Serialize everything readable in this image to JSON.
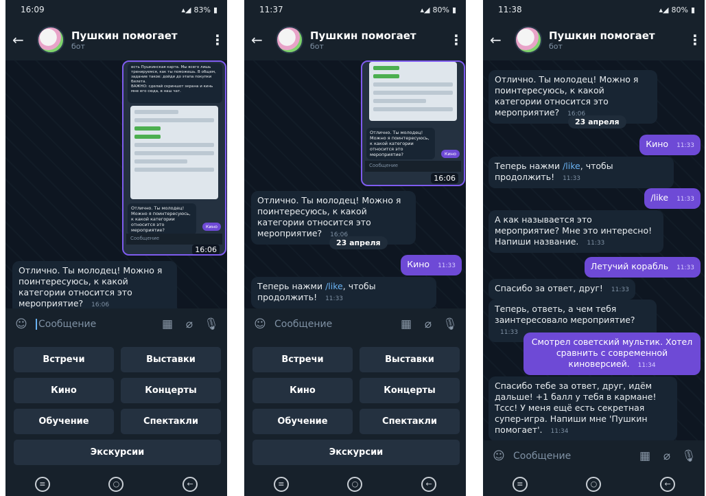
{
  "chat": {
    "title": "Пушкин помогает",
    "subtitle": "бот",
    "input_placeholder": "Сообщение"
  },
  "screens": [
    {
      "status": {
        "time": "16:09",
        "battery": "83%"
      },
      "screenshot_preview": {
        "intro_lines": [
          "есть Пушкинская карта. Мы всего лишь",
          "тренируемся, как ты поможешь. В общем,",
          "задание такое: дойди до этапа покупки",
          "билета.",
          "ВАЖНО: сделай скриншот экрана и кинь",
          "мне его сюда, в наш чат."
        ],
        "bot_message": "Отлично. Ты молодец! Можно я поинтересуюсь, к какой категории относится это мероприятие?",
        "user_reply": "Кино",
        "input": "Сообщение",
        "time": "16:06"
      },
      "messages": [
        {
          "text": "Отлично. Ты молодец! Можно я поинтересуюсь, к какой категории относится это мероприятие?",
          "time": "16:06"
        }
      ]
    },
    {
      "status": {
        "time": "11:37",
        "battery": "80%"
      },
      "screenshot_preview": {
        "bot_message": "Отлично. Ты молодец! Можно я поинтересуюсь, к какой категории относится это мероприятие?",
        "user_reply": "Кино",
        "input": "Сообщение",
        "time": "16:06"
      },
      "messages": [
        {
          "text": "Отлично. Ты молодец! Можно я поинтересуюсь, к какой категории относится это мероприятие?",
          "time": "16:06"
        },
        {
          "date": "23 апреля"
        },
        {
          "text": "Кино",
          "time": "11:33",
          "out": true
        },
        {
          "prefix": "Теперь нажми ",
          "link": "/like",
          "suffix": ", чтобы продолжить!",
          "time": "11:33"
        }
      ]
    },
    {
      "status": {
        "time": "11:38",
        "battery": "80%"
      },
      "messages": [
        {
          "text": "Отлично. Ты молодец! Можно я поинтересуюсь, к какой категории относится это мероприятие?",
          "time": "16:06"
        },
        {
          "date": "23 апреля"
        },
        {
          "text": "Кино",
          "time": "11:33",
          "out": true
        },
        {
          "prefix": "Теперь нажми ",
          "link": "/like",
          "suffix": ", чтобы продолжить!",
          "time": "11:33"
        },
        {
          "text": "/like",
          "time": "11:33",
          "out": true
        },
        {
          "text": "А как называется это мероприятие? Мне это интересно! Напиши название.",
          "time": "11:33"
        },
        {
          "text": "Летучий корабль",
          "time": "11:33",
          "out": true
        },
        {
          "text": "Спасибо за ответ, друг!",
          "time": "11:33"
        },
        {
          "text": "Теперь, ответь, а чем тебя заинтересовало мероприятие?",
          "time": "11:33"
        },
        {
          "text": "Смотрел советский мультик. Хотел сравнить с современной киноверсией.",
          "time": "11:34",
          "out": true
        },
        {
          "text": "Спасибо тебе за ответ, друг, идём дальше! +1 балл у тебя в кармане! Тссс! У меня ещё есть секретная супер-игра. Напиши мне 'Пушкин помогает'.",
          "time": "11:34"
        }
      ]
    }
  ],
  "keyboard": [
    "Встречи",
    "Выставки",
    "Кино",
    "Концерты",
    "Обучение",
    "Спектакли",
    "Экскурсии"
  ]
}
